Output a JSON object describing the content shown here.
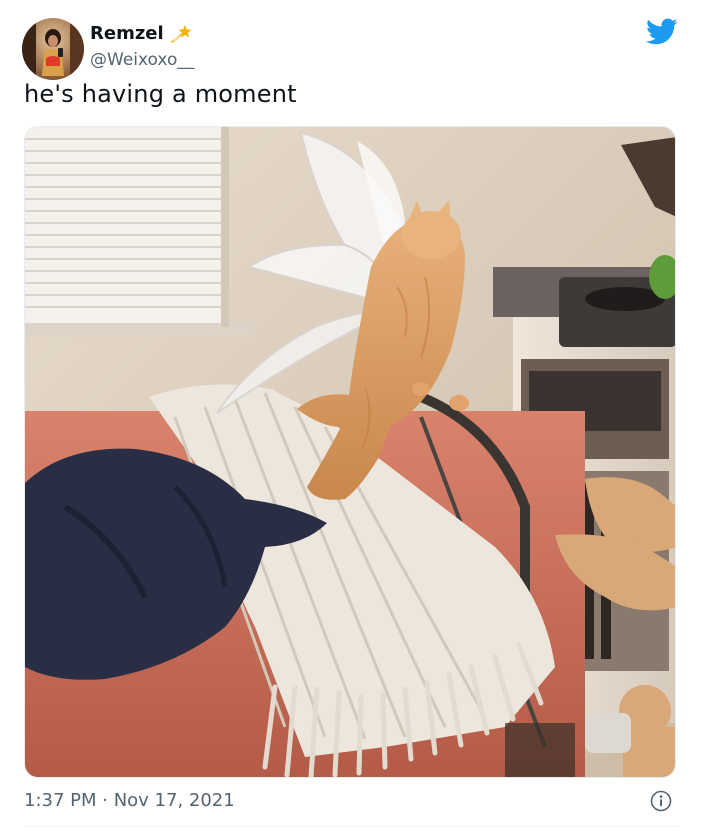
{
  "tweet": {
    "display_name": "Remzel",
    "handle": "@Weixoxo__",
    "text": "he's having a moment",
    "timestamp": "1:37 PM · Nov 17, 2021"
  },
  "icons": {
    "brand": "twitter-bird-icon",
    "badge": "shooting-star-emoji-icon",
    "info": "info-icon"
  },
  "colors": {
    "twitter_blue": "#1d9bf0",
    "secondary_text": "#536471",
    "primary_text": "#0f1419"
  }
}
